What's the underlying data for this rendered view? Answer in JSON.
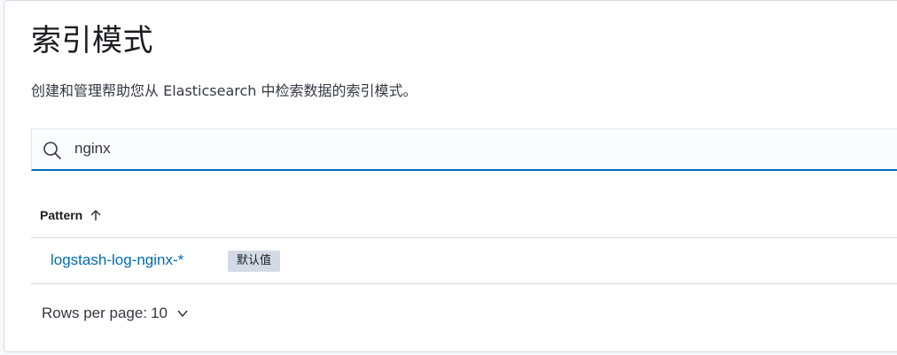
{
  "page": {
    "title": "索引模式",
    "subtitle": "创建和管理帮助您从 Elasticsearch 中检索数据的索引模式。"
  },
  "search": {
    "value": "nginx",
    "placeholder": ""
  },
  "table": {
    "columns": [
      {
        "label": "Pattern",
        "sort": "ascending"
      }
    ],
    "rows": [
      {
        "pattern": "logstash-log-nginx-*",
        "badge": "默认值"
      }
    ]
  },
  "pagination": {
    "label": "Rows per page:",
    "value": "10"
  },
  "icons": {
    "search": "search-icon",
    "sort": "arrow-up-icon",
    "dropdown": "chevron-down-icon"
  },
  "colors": {
    "link": "#006bb8",
    "focus_border": "#006bb8",
    "badge_bg": "#d3dae6"
  }
}
